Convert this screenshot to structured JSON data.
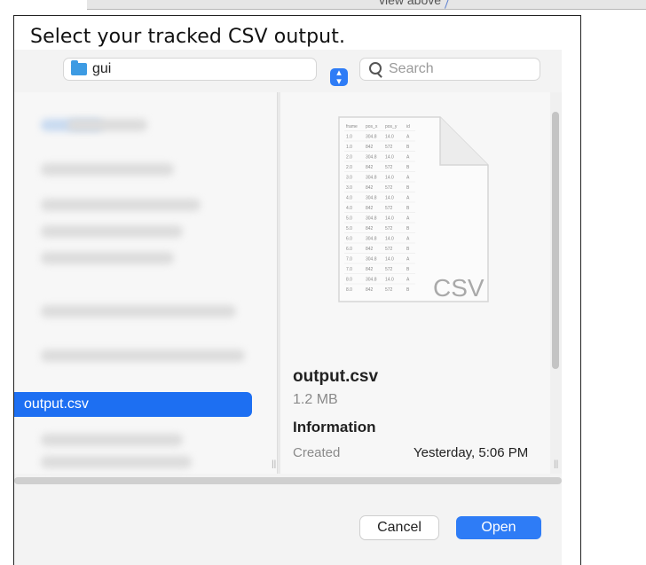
{
  "background_peek": {
    "text": "view above"
  },
  "caption": "Select your tracked CSV output.",
  "dialog": {
    "folder_popup": {
      "label": "gui",
      "icon": "folder-icon"
    },
    "search": {
      "placeholder": "Search",
      "icon": "search-icon"
    },
    "file_list": {
      "selected_item": "output.csv"
    },
    "preview": {
      "icon_badge": "CSV",
      "file_name": "output.csv",
      "file_size": "1.2 MB",
      "info_heading": "Information",
      "info_rows": [
        {
          "label": "Created",
          "value": "Yesterday, 5:06 PM"
        }
      ],
      "thumbnail_table": {
        "headers": [
          "frame",
          "pos_x",
          "pos_y",
          "id"
        ],
        "rows": [
          [
            "1.0",
            "304.8",
            "14.0",
            "A"
          ],
          [
            "1.0",
            "842",
            "572",
            "B"
          ],
          [
            "2.0",
            "304.8",
            "14.0",
            "A"
          ],
          [
            "2.0",
            "842",
            "572",
            "B"
          ],
          [
            "3.0",
            "304.8",
            "14.0",
            "A"
          ],
          [
            "3.0",
            "842",
            "572",
            "B"
          ],
          [
            "4.0",
            "304.8",
            "14.0",
            "A"
          ],
          [
            "4.0",
            "842",
            "572",
            "B"
          ],
          [
            "5.0",
            "304.8",
            "14.0",
            "A"
          ],
          [
            "5.0",
            "842",
            "572",
            "B"
          ],
          [
            "6.0",
            "304.8",
            "14.0",
            "A"
          ],
          [
            "6.0",
            "842",
            "572",
            "B"
          ],
          [
            "7.0",
            "304.8",
            "14.0",
            "A"
          ],
          [
            "7.0",
            "842",
            "572",
            "B"
          ],
          [
            "8.0",
            "304.8",
            "14.0",
            "A"
          ],
          [
            "8.0",
            "842",
            "572",
            "B"
          ]
        ]
      }
    },
    "buttons": {
      "cancel": "Cancel",
      "open": "Open"
    },
    "colors": {
      "accent": "#2e7cf6",
      "selection": "#1d6ff2",
      "folder": "#3d9be3"
    }
  }
}
